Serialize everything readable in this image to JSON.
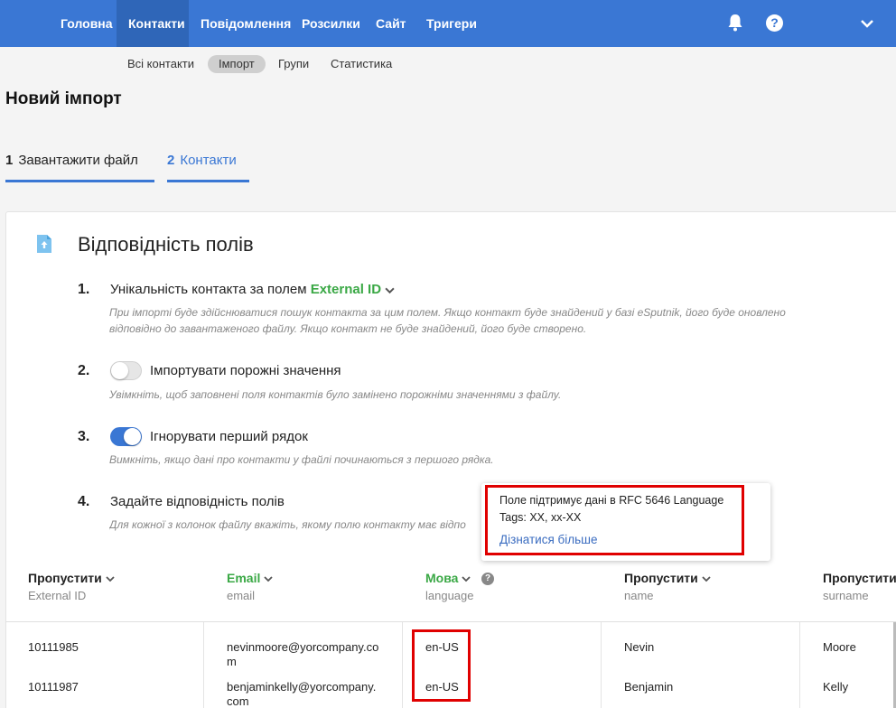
{
  "topnav": {
    "items": [
      {
        "label": "Головна"
      },
      {
        "label": "Контакти"
      },
      {
        "label": "Повідомлення"
      },
      {
        "label": "Розсилки"
      },
      {
        "label": "Сайт"
      },
      {
        "label": "Тригери"
      }
    ],
    "icons": [
      "bell-icon",
      "help-icon",
      "chevron-down-icon"
    ],
    "help_glyph": "?",
    "accent_color": "#3a77d4"
  },
  "subnav": {
    "items": [
      {
        "label": "Всі контакти"
      },
      {
        "label": "Імпорт"
      },
      {
        "label": "Групи"
      },
      {
        "label": "Статистика"
      }
    ]
  },
  "page": {
    "title": "Новий імпорт"
  },
  "steps": [
    {
      "num": "1",
      "label": "Завантажити файл"
    },
    {
      "num": "2",
      "label": "Контакти"
    }
  ],
  "card": {
    "title": "Відповідність полів",
    "items": [
      {
        "num": "1.",
        "text": "Унікальність контакта за полем",
        "field": "External ID",
        "desc": "При імпорті буде здійснюватися пошук контакта за цим полем. Якщо контакт буде знайдений у базі eSputnik, його буде оновлено відповідно до завантаженого файлу. Якщо контакт не буде знайдений, його буде створено."
      },
      {
        "num": "2.",
        "text": "Імпортувати порожні значення",
        "desc": "Увімкніть, щоб заповнені поля контактів було замінено порожніми значеннями з файлу.",
        "toggle_on": false
      },
      {
        "num": "3.",
        "text": "Ігнорувати перший рядок",
        "desc": "Вимкніть, якщо дані про контакти у файлі починаються з першого рядка.",
        "toggle_on": true
      },
      {
        "num": "4.",
        "text": "Задайте відповідність полів",
        "desc": "Для кожної з колонок файлу вкажіть, якому полю контакту має відпо"
      }
    ]
  },
  "tooltip": {
    "text": "Поле підтримує дані в RFC 5646 Language Tags: XX, xx-XX",
    "link": "Дізнатися більше"
  },
  "table": {
    "columns": [
      {
        "head": "Пропустити",
        "sub": "External ID",
        "mapped": false
      },
      {
        "head": "Email",
        "sub": "email",
        "mapped": true
      },
      {
        "head": "Мова",
        "sub": "language",
        "mapped": true
      },
      {
        "head": "Пропустити",
        "sub": "name",
        "mapped": false
      },
      {
        "head": "Пропустити",
        "sub": "surname",
        "mapped": false
      }
    ],
    "help_glyph": "?",
    "rows": [
      [
        "10111985",
        "nevinmoore@yorcompany.com",
        "en-US",
        "Nevin",
        "Moore"
      ],
      [
        "10111987",
        "benjaminkelly@yorcompany.com",
        "en-US",
        "Benjamin",
        "Kelly"
      ]
    ],
    "email_wrapped": [
      [
        "nevinmoore@yorcompany.co",
        "m"
      ],
      [
        "benjaminkelly@yorcompany.",
        "com"
      ]
    ]
  },
  "colors": {
    "mapped_green": "#3aa845",
    "highlight_red": "#e00000"
  }
}
